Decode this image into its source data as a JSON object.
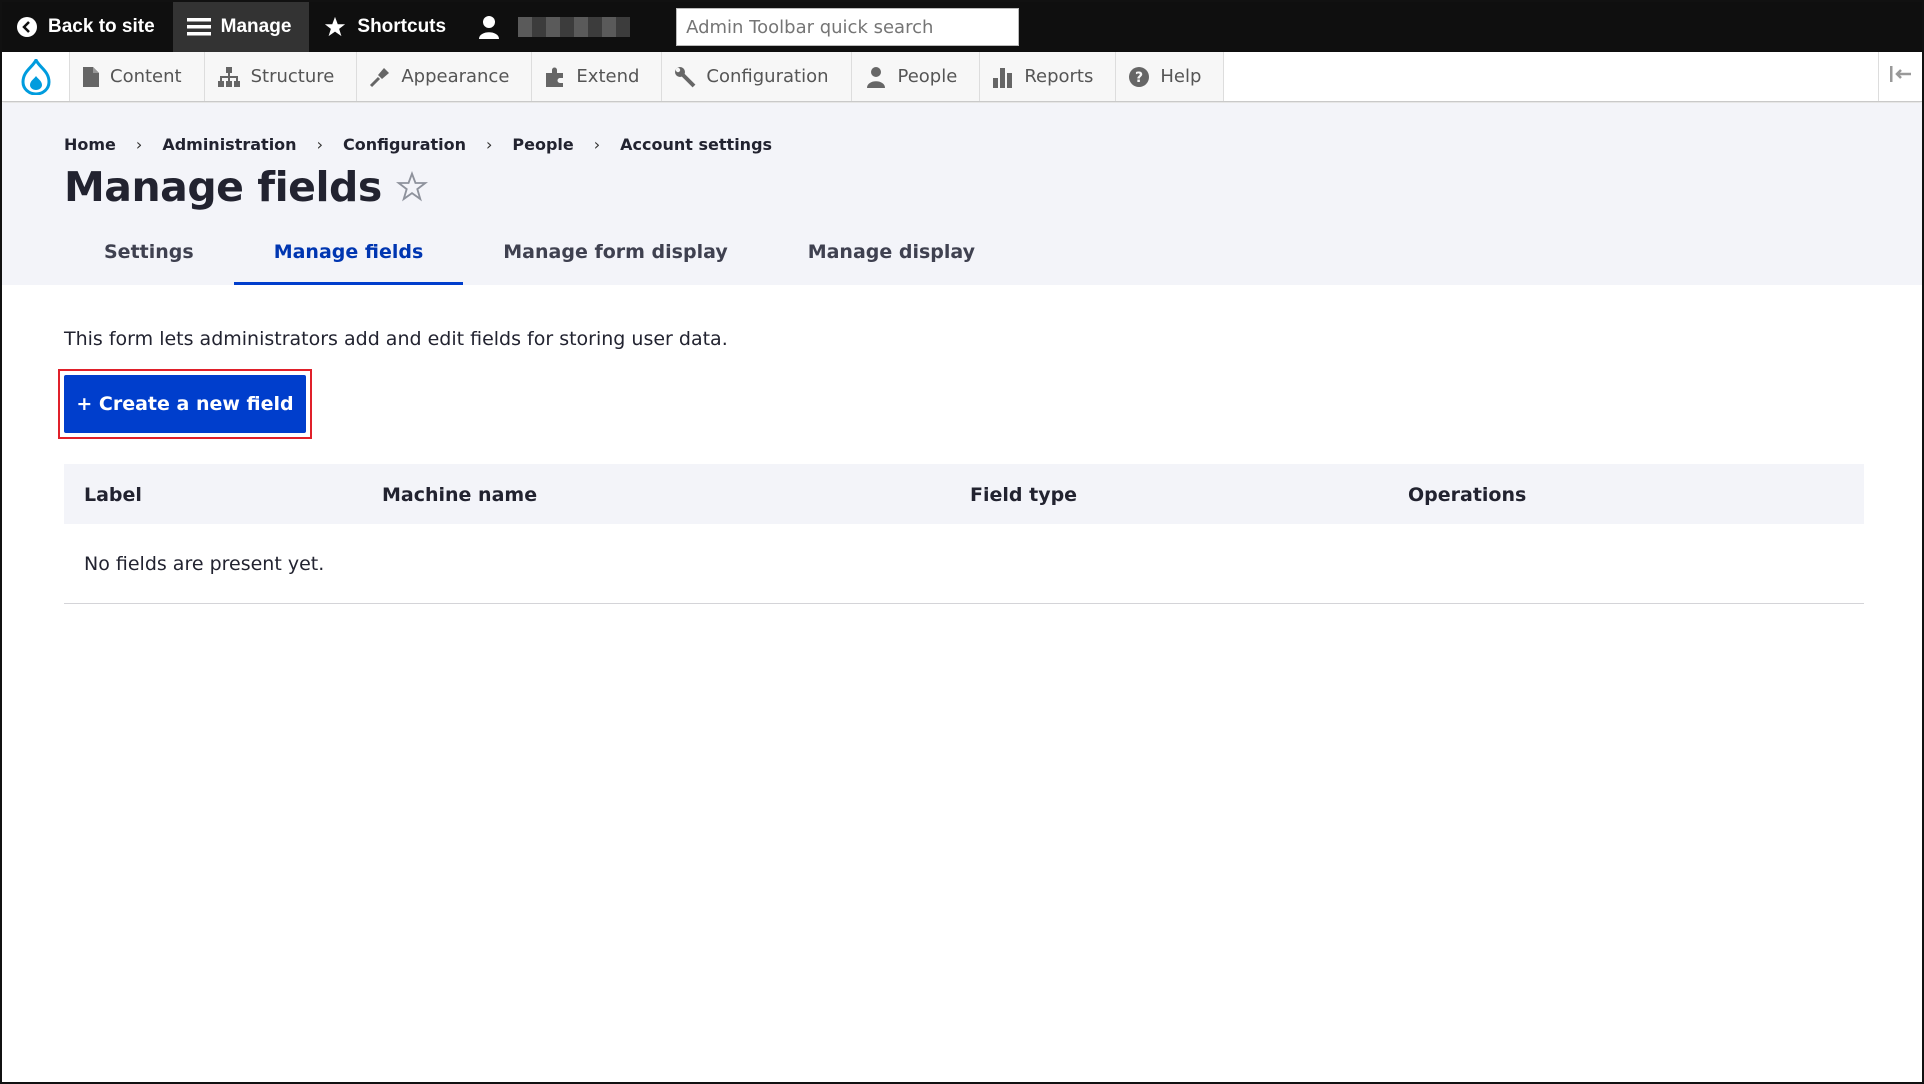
{
  "toolbar": {
    "back_to_site": "Back to site",
    "manage": "Manage",
    "shortcuts": "Shortcuts",
    "search_placeholder": "Admin Toolbar quick search"
  },
  "menu": {
    "items": [
      {
        "label": "Content",
        "icon": "document-icon"
      },
      {
        "label": "Structure",
        "icon": "structure-icon"
      },
      {
        "label": "Appearance",
        "icon": "paintbrush-icon"
      },
      {
        "label": "Extend",
        "icon": "puzzle-icon"
      },
      {
        "label": "Configuration",
        "icon": "wrench-icon"
      },
      {
        "label": "People",
        "icon": "people-icon"
      },
      {
        "label": "Reports",
        "icon": "bar-chart-icon"
      },
      {
        "label": "Help",
        "icon": "help-icon"
      }
    ]
  },
  "breadcrumb": [
    "Home",
    "Administration",
    "Configuration",
    "People",
    "Account settings"
  ],
  "page": {
    "title": "Manage fields",
    "tabs": [
      "Settings",
      "Manage fields",
      "Manage form display",
      "Manage display"
    ],
    "active_tab": "Manage fields",
    "description": "This form lets administrators add and edit fields for storing user data.",
    "create_button": "+ Create a new field"
  },
  "table": {
    "headers": [
      "Label",
      "Machine name",
      "Field type",
      "Operations"
    ],
    "empty_message": "No fields are present yet."
  },
  "colors": {
    "accent": "#003ecc",
    "toolbar_bg": "#0f0f0f",
    "header_bg": "#f3f4f9",
    "highlight": "#e0202a"
  }
}
